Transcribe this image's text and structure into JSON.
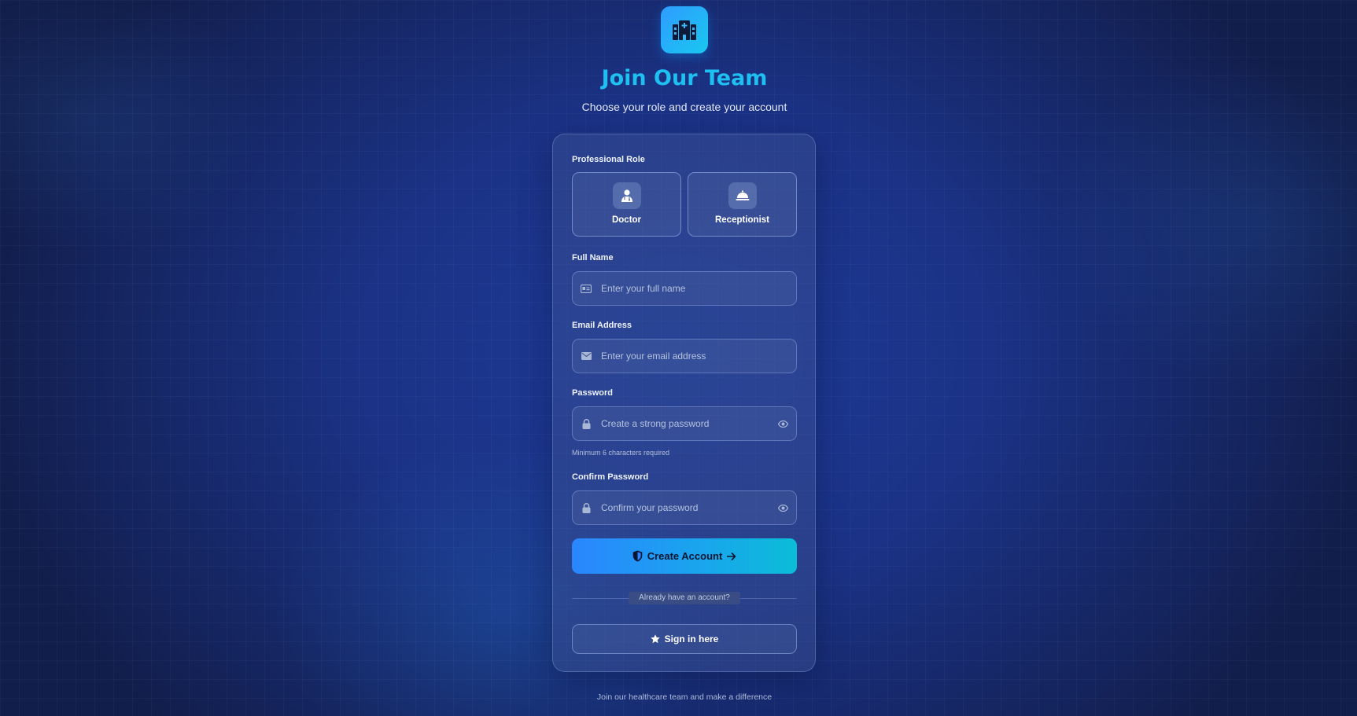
{
  "header": {
    "logo_icon": "hospital-icon",
    "title": "Join Our Team",
    "subtitle": "Choose your role and create your account"
  },
  "form": {
    "role_label": "Professional Role",
    "roles": [
      {
        "label": "Doctor",
        "icon": "doctor-icon"
      },
      {
        "label": "Receptionist",
        "icon": "service-bell-icon"
      }
    ],
    "full_name": {
      "label": "Full Name",
      "placeholder": "Enter your full name",
      "value": "",
      "icon": "id-card-icon"
    },
    "email": {
      "label": "Email Address",
      "placeholder": "Enter your email address",
      "value": "",
      "icon": "envelope-icon"
    },
    "password": {
      "label": "Password",
      "placeholder": "Create a strong password",
      "value": "",
      "icon": "lock-icon",
      "hint": "Minimum 6 characters required"
    },
    "confirm_password": {
      "label": "Confirm Password",
      "placeholder": "Confirm your password",
      "value": "",
      "icon": "lock-icon"
    },
    "submit_label": "Create Account",
    "divider_text": "Already have an account?",
    "signin_label": "Sign in here"
  },
  "footer": {
    "text": "Join our healthcare team and make a difference"
  },
  "colors": {
    "accent": "#1ec0f2",
    "button_gradient_start": "#2a86ff",
    "button_gradient_end": "#0bbcd8",
    "background": "#1b3285"
  }
}
